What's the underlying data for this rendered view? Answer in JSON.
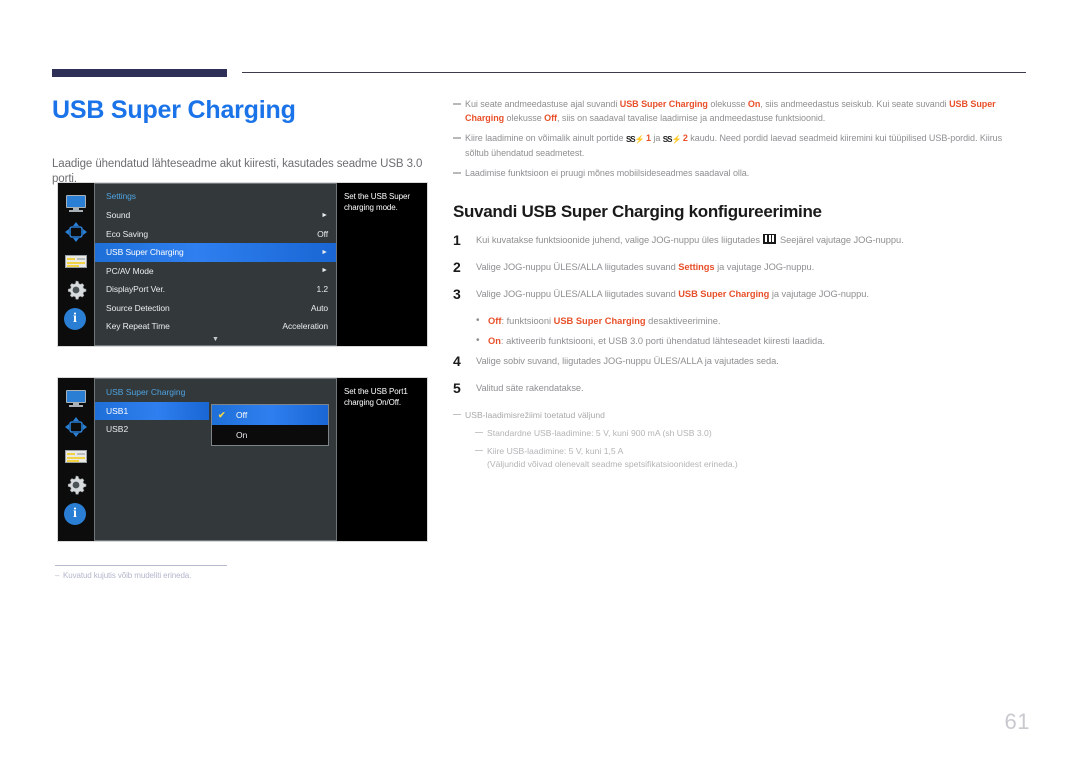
{
  "page_title": "USB Super Charging",
  "intro": "Laadige ühendatud lähteseadme akut kiiresti, kasutades seadme USB 3.0 porti.",
  "osd1": {
    "menu_title": "Settings",
    "rows": [
      {
        "label": "Sound",
        "value": "",
        "arrow": "►",
        "selected": false
      },
      {
        "label": "Eco Saving",
        "value": "Off",
        "arrow": "",
        "selected": false
      },
      {
        "label": "USB Super Charging",
        "value": "",
        "arrow": "►",
        "selected": true
      },
      {
        "label": "PC/AV Mode",
        "value": "",
        "arrow": "►",
        "selected": false
      },
      {
        "label": "DisplayPort Ver.",
        "value": "1.2",
        "arrow": "",
        "selected": false
      },
      {
        "label": "Source Detection",
        "value": "Auto",
        "arrow": "",
        "selected": false
      },
      {
        "label": "Key Repeat Time",
        "value": "Acceleration",
        "arrow": "",
        "selected": false
      }
    ],
    "scroll_down": "▼",
    "description": "Set the USB Super charging mode."
  },
  "osd2": {
    "menu_title": "USB Super Charging",
    "rows": [
      {
        "label": "USB1",
        "selected": true
      },
      {
        "label": "USB2",
        "selected": false
      }
    ],
    "dropdown": [
      {
        "label": "Off",
        "checked": true,
        "check": "✔"
      },
      {
        "label": "On",
        "checked": false,
        "check": ""
      }
    ],
    "description": "Set the USB Port1 charging On/Off."
  },
  "image_footnote": "Kuvatud kujutis võib mudeliti erineda.",
  "image_footnote_dash": "–",
  "notes": [
    {
      "parts": [
        {
          "t": "Kui seate andmeedastuse ajal suvandi ",
          "b": false
        },
        {
          "t": "USB Super Charging",
          "b": true
        },
        {
          "t": " olekusse ",
          "b": false
        },
        {
          "t": "On",
          "b": true
        },
        {
          "t": ", siis andmeedastus seiskub. Kui seate suvandi ",
          "b": false
        },
        {
          "t": "USB Super Charging",
          "b": true
        },
        {
          "t": " olekusse ",
          "b": false
        },
        {
          "t": "Off",
          "b": true
        },
        {
          "t": ", siis on saadaval tavalise laadimise ja andmeedastuse funktsioonid.",
          "b": false
        }
      ]
    },
    {
      "parts": [
        {
          "t": "Kiire laadimine on võimalik ainult portide ",
          "b": false
        },
        {
          "t": "SS⚡",
          "b": false,
          "icon": true
        },
        {
          "t": " 1",
          "b": true
        },
        {
          "t": " ja ",
          "b": false
        },
        {
          "t": "SS⚡",
          "b": false,
          "icon": true
        },
        {
          "t": " 2",
          "b": true
        },
        {
          "t": " kaudu. Need pordid laevad seadmeid kiiremini kui tüüpilised USB-pordid. Kiirus sõltub ühendatud seadmetest.",
          "b": false
        }
      ]
    },
    {
      "parts": [
        {
          "t": "Laadimise funktsioon ei pruugi mõnes mobiilsideseadmes saadaval olla.",
          "b": false
        }
      ]
    }
  ],
  "section_heading": "Suvandi USB Super Charging konfigureerimine",
  "steps": [
    {
      "num": "1",
      "parts": [
        {
          "t": "Kui kuvatakse funktsioonide juhend, valige JOG-nuppu üles liigutades ",
          "b": false
        },
        {
          "t": "",
          "b": false,
          "menuicon": true
        },
        {
          "t": " Seejärel vajutage JOG-nuppu.",
          "b": false
        }
      ]
    },
    {
      "num": "2",
      "parts": [
        {
          "t": "Valige JOG-nuppu ÜLES/ALLA liigutades suvand ",
          "b": false
        },
        {
          "t": "Settings",
          "b": true
        },
        {
          "t": " ja vajutage JOG-nuppu.",
          "b": false
        }
      ]
    },
    {
      "num": "3",
      "parts": [
        {
          "t": "Valige JOG-nuppu ÜLES/ALLA liigutades suvand ",
          "b": false
        },
        {
          "t": "USB Super Charging",
          "b": true
        },
        {
          "t": " ja vajutage JOG-nuppu.",
          "b": false
        }
      ]
    }
  ],
  "bullets": [
    {
      "dot": "•",
      "parts": [
        {
          "t": "Off",
          "b": true
        },
        {
          "t": ": funktsiooni ",
          "b": false
        },
        {
          "t": "USB Super Charging",
          "b": true
        },
        {
          "t": " desaktiveerimine.",
          "b": false
        }
      ]
    },
    {
      "dot": "•",
      "parts": [
        {
          "t": "On",
          "b": true
        },
        {
          "t": ": aktiveerib funktsiooni, et USB 3.0 porti ühendatud lähteseadet kiiresti laadida.",
          "b": false
        }
      ]
    }
  ],
  "steps2": [
    {
      "num": "4",
      "parts": [
        {
          "t": "Valige sobiv suvand, liigutades JOG-nuppu ÜLES/ALLA ja vajutades seda.",
          "b": false
        }
      ]
    },
    {
      "num": "5",
      "parts": [
        {
          "t": "Valitud säte rakendatakse.",
          "b": false
        }
      ]
    }
  ],
  "tail": {
    "line1": "USB-laadimisrežiimi toetatud väljund",
    "line2": "Standardne USB-laadimine: 5 V, kuni 900 mA (sh USB 3.0)",
    "line3": "Kiire USB-laadimine: 5 V, kuni 1,5 A",
    "line4": "(Väljundid võivad olenevalt seadme spetsifikatsioonidest erineda.)"
  },
  "page_number": "61",
  "colors": {
    "title_blue": "#1a73e8",
    "accent_red": "#e8502a",
    "header_navy": "#2e3057",
    "osd_highlight": "#2f7ff0",
    "osd_bg": "#33383b",
    "osd_title_blue": "#4ea3e0",
    "check_yellow": "#f2d24a"
  }
}
